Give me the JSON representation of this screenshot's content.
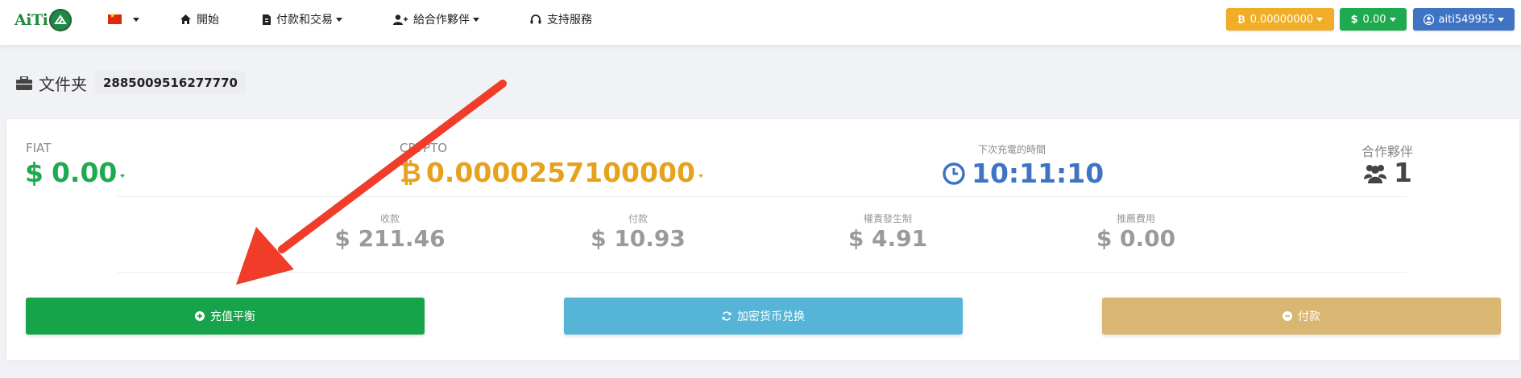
{
  "nav": {
    "logo_text": "AiTi",
    "items": [
      {
        "label": "開始",
        "icon": "home-icon"
      },
      {
        "label": "付款和交易",
        "icon": "document-icon"
      },
      {
        "label": "給合作夥伴",
        "icon": "user-plus-icon"
      },
      {
        "label": "支持服務",
        "icon": "headset-icon"
      }
    ],
    "btc_balance": "0.00000000",
    "usd_balance": "0.00",
    "username": "aiti549955"
  },
  "header": {
    "title": "文件夹",
    "account_id": "2885009516277770"
  },
  "stats": {
    "fiat_label": "FIAT",
    "fiat_value": "0.00",
    "crypto_label": "CRYPTO",
    "crypto_value": "0.0000257100000",
    "next_charge_label": "下次充電的時間",
    "next_charge_time": "10:11:10",
    "partners_label": "合作夥伴",
    "partners_count": "1",
    "income_label": "收款",
    "income_value": "$ 211.46",
    "payout_label": "付款",
    "payout_value": "$ 10.93",
    "equity_label": "權責發生制",
    "equity_value": "$ 4.91",
    "referral_label": "推薦費用",
    "referral_value": "$ 0.00"
  },
  "actions": {
    "topup": "充值平衡",
    "exchange": "加密货币兑换",
    "payout": "付款"
  },
  "colors": {
    "btc_button": "#f0ad27",
    "usd_button": "#1eaa4f",
    "user_button": "#3f73c4",
    "topup_button": "#17a34a",
    "exchange_button": "#56b4d6",
    "payout_button": "#d9b671",
    "arrow": "#ef3d2a"
  }
}
